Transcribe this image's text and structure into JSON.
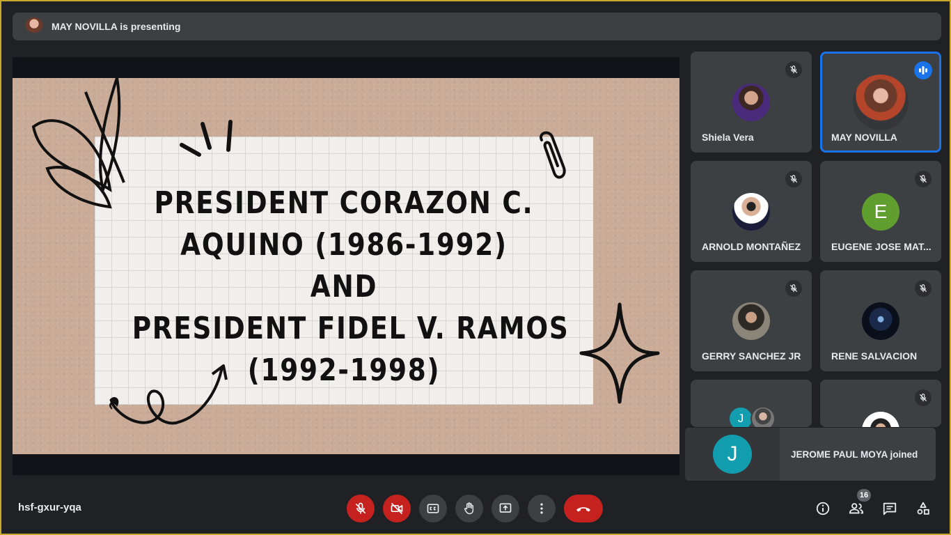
{
  "banner": {
    "text": "MAY NOVILLA is presenting"
  },
  "slide": {
    "lines": [
      "PRESIDENT CORAZON C.",
      "AQUINO (1986-1992)",
      "AND",
      "PRESIDENT FIDEL V. RAMOS",
      "(1992-1998)"
    ]
  },
  "participants": [
    {
      "name": "Shiela Vera",
      "muted": true,
      "avatar": "photo"
    },
    {
      "name": "MAY NOVILLA",
      "muted": false,
      "speaking": true,
      "avatar": "photo"
    },
    {
      "name": "ARNOLD MONTAÑEZ",
      "muted": true,
      "avatar": "photo"
    },
    {
      "name": "EUGENE JOSE MAT...",
      "muted": true,
      "avatar": "letter",
      "letter": "E",
      "color": "#5f9e2f"
    },
    {
      "name": "GERRY SANCHEZ JR",
      "muted": true,
      "avatar": "photo"
    },
    {
      "name": "RENE SALVACION",
      "muted": true,
      "avatar": "photo"
    },
    {
      "name": "",
      "avatar": "group",
      "letter": "J",
      "color": "#129eaf"
    },
    {
      "name": "",
      "muted": true,
      "avatar": "photo"
    }
  ],
  "toast": {
    "letter": "J",
    "text": "JEROME PAUL MOYA joined"
  },
  "meeting": {
    "code": "hsf-gxur-yqa"
  },
  "people_count": "16",
  "colors": {
    "accent": "#1a73e8",
    "danger": "#c5221f",
    "surface": "#3c4043",
    "background": "#202124"
  },
  "icons": [
    "mic-off-icon",
    "camera-off-icon",
    "captions-icon",
    "raise-hand-icon",
    "present-icon",
    "more-icon",
    "end-call-icon",
    "info-icon",
    "people-icon",
    "chat-icon",
    "activities-icon"
  ]
}
